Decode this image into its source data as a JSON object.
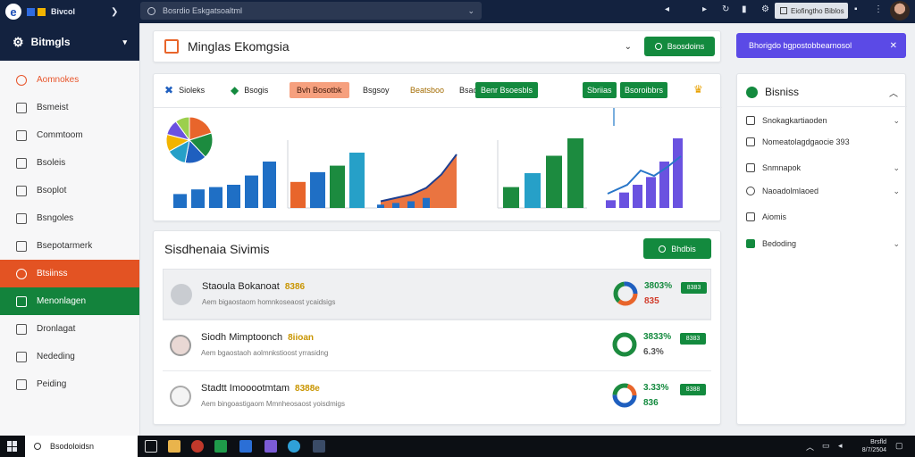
{
  "topbar": {
    "app_name": "Bivcol",
    "search_placeholder": "Bosrdio Eskgatsoaltml",
    "field_text": "Eiofingtho Biblos"
  },
  "sidebar": {
    "title": "Bitmgls",
    "items": [
      {
        "label": "Aomnokes"
      },
      {
        "label": "Bsmeist"
      },
      {
        "label": "Commtoom"
      },
      {
        "label": "Bsoleis"
      },
      {
        "label": "Bsoplot"
      },
      {
        "label": "Bsngoles"
      },
      {
        "label": "Bsepotarmerk"
      },
      {
        "label": "Btsiinss"
      },
      {
        "label": "Menonlagen"
      },
      {
        "label": "Dronlagat"
      },
      {
        "label": "Nededing"
      },
      {
        "label": "Peiding"
      }
    ]
  },
  "header": {
    "title": "Minglas Ekomgsia",
    "button": "Bsosdoins"
  },
  "purple_button": "Bhorigdo bgpostobbearnosol",
  "chart_tabs": [
    {
      "label": "Sioleks"
    },
    {
      "label": "Bsogis"
    },
    {
      "label": "Bvh Bosotbk"
    },
    {
      "label": "Bsgsoy"
    },
    {
      "label": "Beatsboo"
    },
    {
      "label": "Bsao"
    },
    {
      "label": "Benr Bsoesbls"
    },
    {
      "label": "Sbriias"
    },
    {
      "label": "Bsoroibbrs"
    }
  ],
  "chart_data": [
    {
      "type": "pie",
      "values": [
        20,
        18,
        15,
        14,
        12,
        11,
        10
      ],
      "colors": [
        "#e8652b",
        "#1c8b3f",
        "#1f5fbf",
        "#26a0c8",
        "#f2b400",
        "#6a52e0",
        "#9ccf4d"
      ]
    },
    {
      "type": "bar",
      "values": [
        3,
        4,
        4.5,
        5,
        7,
        10
      ],
      "color": "#1f6fc5"
    },
    {
      "type": "bar",
      "values": [
        4,
        5.5,
        6.5,
        8.5
      ],
      "colors": [
        "#e8652b",
        "#1f6fc5",
        "#1c8b3f",
        "#26a0c8"
      ]
    },
    {
      "type": "area",
      "values": [
        1,
        1.5,
        2,
        3,
        5,
        8
      ],
      "colors": [
        "#1f6fc5",
        "#e8652b"
      ]
    },
    {
      "type": "bar",
      "values": [
        3,
        5,
        7.5,
        10
      ],
      "colors": [
        "#1c8b3f",
        "#26a0c8",
        "#1c8b3f",
        "#1c8b3f"
      ]
    },
    {
      "type": "bar",
      "values": [
        1,
        2,
        3,
        4,
        6,
        9
      ],
      "color": "#6a52e0"
    }
  ],
  "list": {
    "title": "Sisdhenaia Sivimis",
    "button": "Bhdbis",
    "rows": [
      {
        "name": "Staoula Bokanoat",
        "badge": "8386",
        "sub": "Aem bigaostaom homnkoseaost ycaidsigs",
        "pct": "3803%",
        "pct2": "835",
        "pct2_color": "#d13b2a",
        "tag": "8383"
      },
      {
        "name": "Siodh Mimptoonch",
        "badge": "8iioan",
        "sub": "Aem bgaostaoh aolmnkstioost yrrasidng",
        "pct": "3833%",
        "pct2": "6.3%",
        "pct2_color": "#555555",
        "tag": "8383"
      },
      {
        "name": "Stadtt Imooootmtam",
        "badge": "8388e",
        "sub": "Aem bingoastigaom Mmnheosaost yoisdmigs",
        "pct": "3.33%",
        "pct2": "836",
        "pct2_color": "#138a3e",
        "tag": "8388"
      }
    ]
  },
  "right_panel": {
    "title": "Bisniss",
    "items": [
      {
        "label": "Snokagkartiaoden"
      },
      {
        "label": "Nomeatolagdgaocie 393"
      },
      {
        "label": "Snmnapok"
      },
      {
        "label": "Naoadolmlaoed"
      },
      {
        "label": "Aiomis"
      },
      {
        "label": "Bedoding"
      }
    ]
  },
  "taskbar": {
    "search_text": "Bsodoloidsn",
    "clock_time": "Brsfld",
    "clock_date": "8/7/2504"
  }
}
